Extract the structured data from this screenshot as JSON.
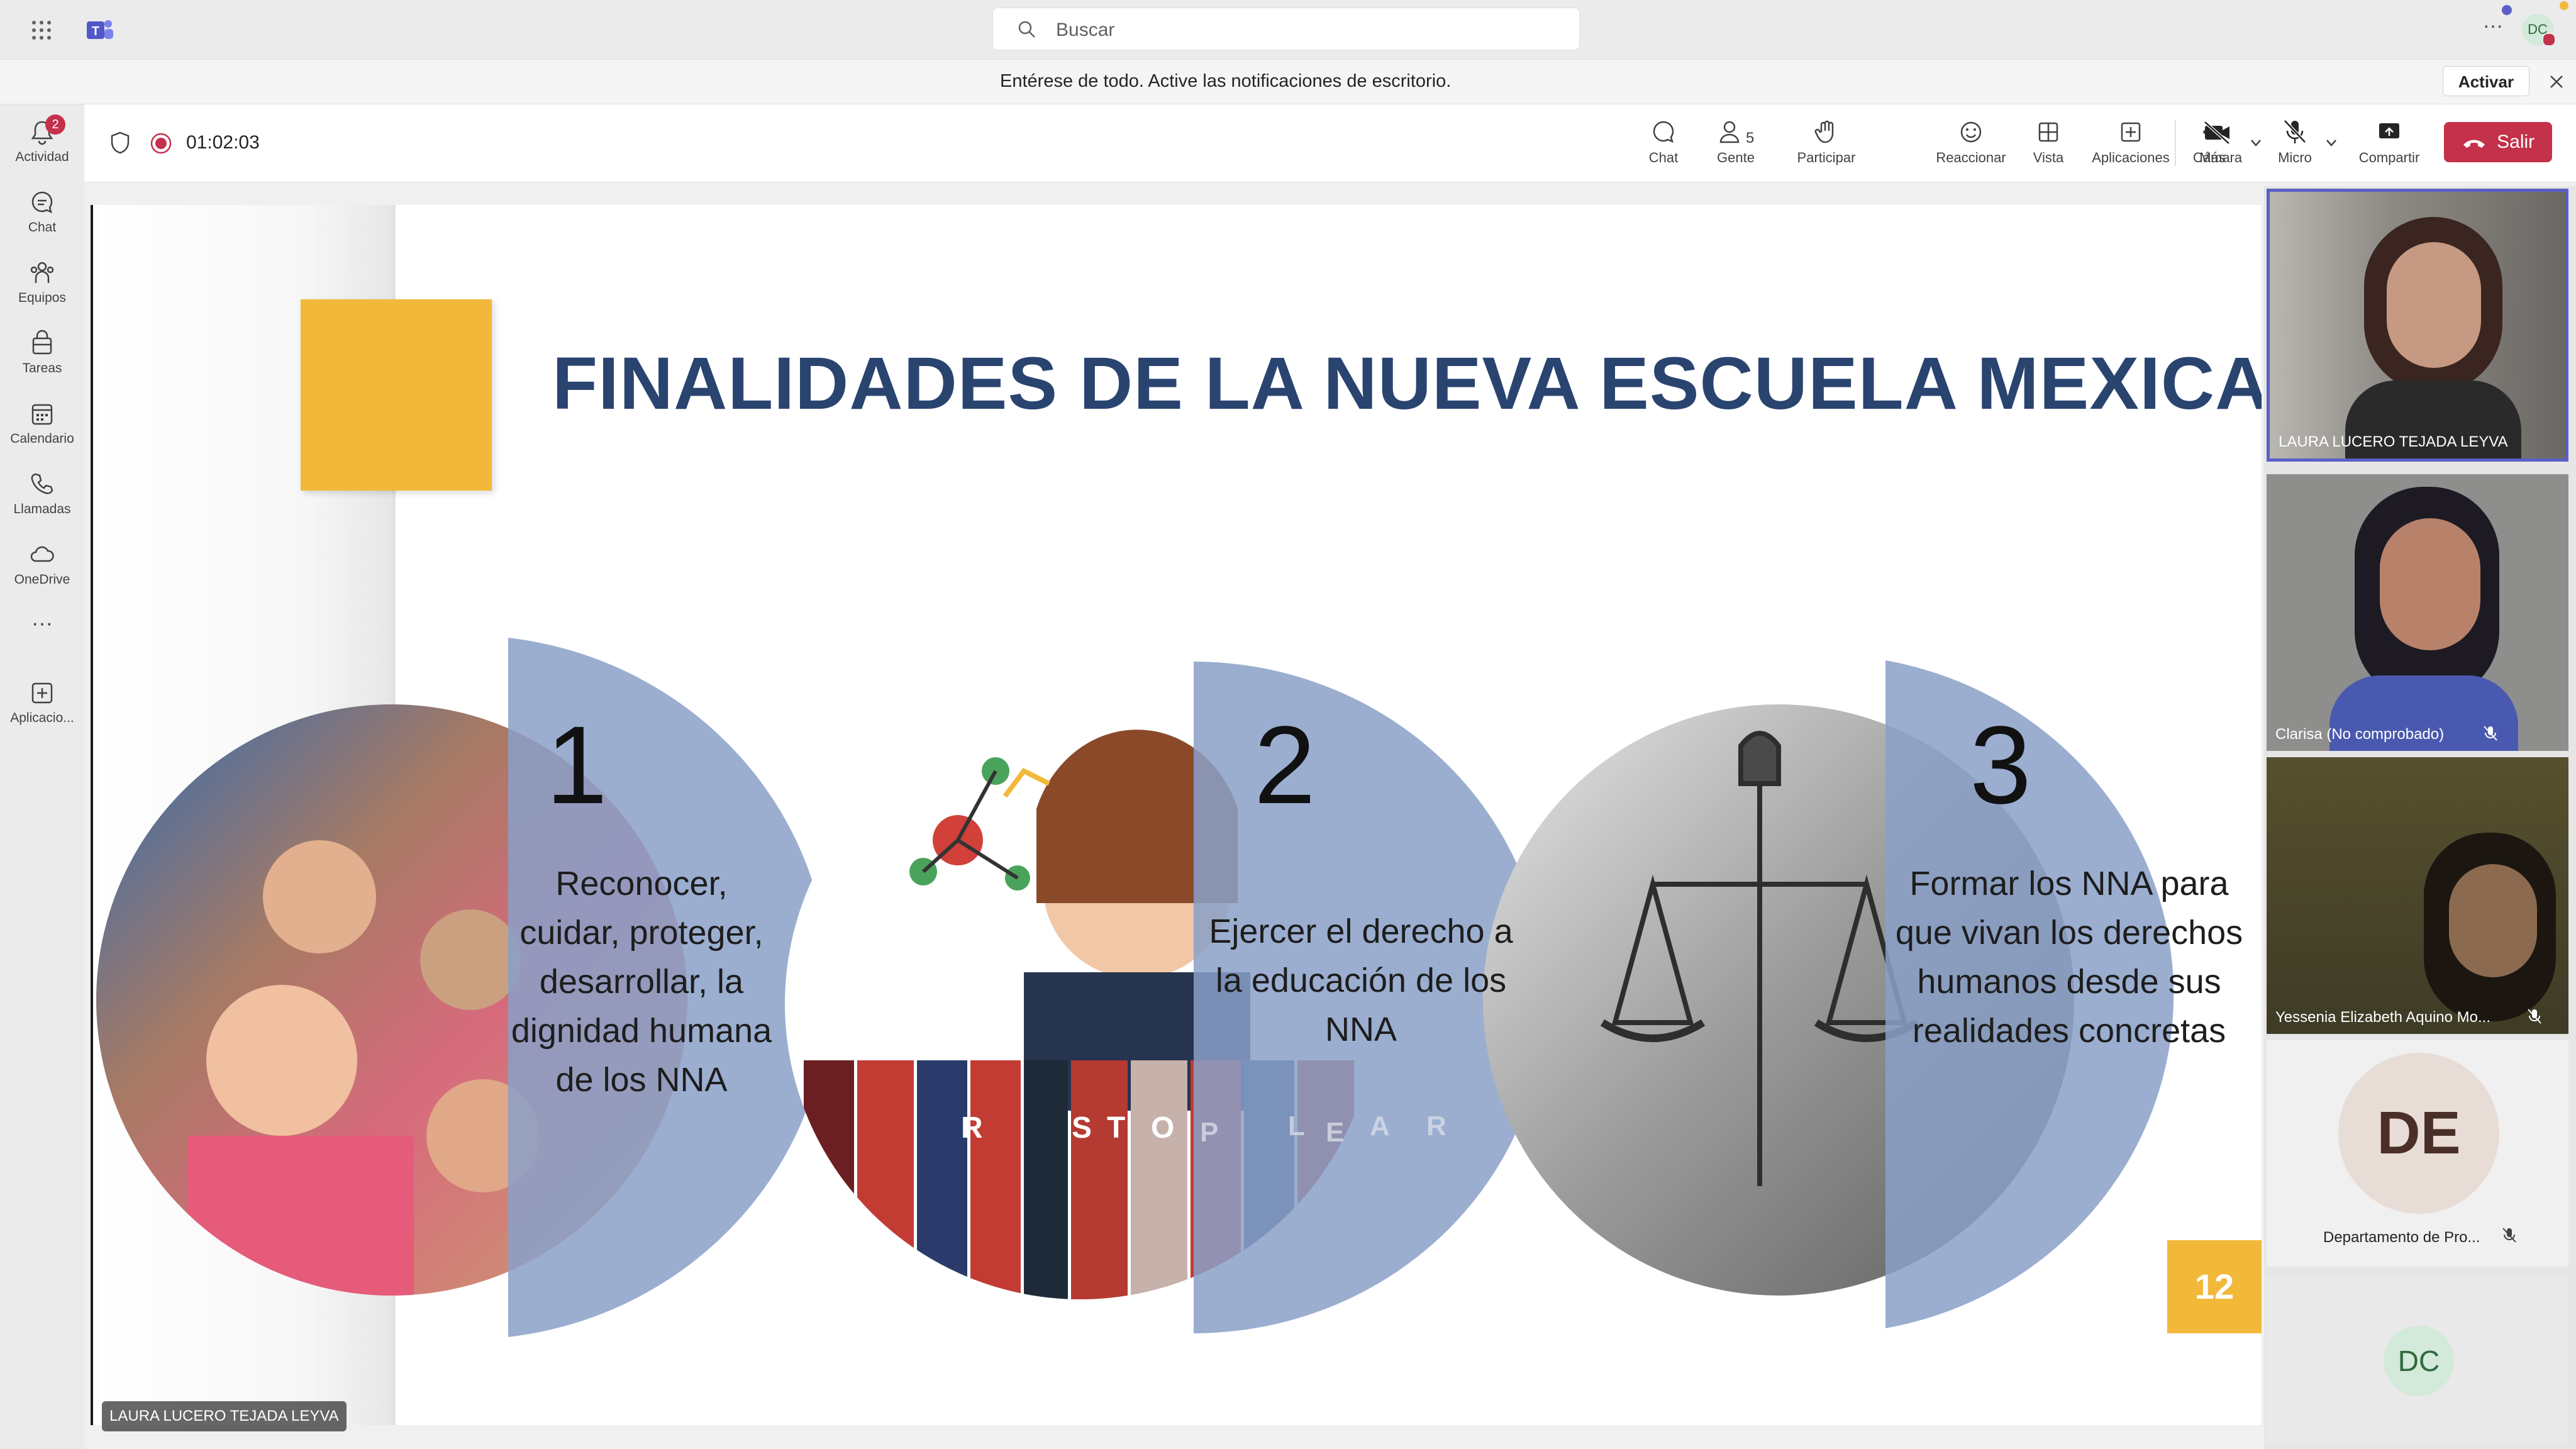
{
  "topbar": {
    "search_placeholder": "Buscar",
    "more_label": "···",
    "user_initials": "DC"
  },
  "notification": {
    "text": "Entérese de todo. Active las notificaciones de escritorio.",
    "button": "Activar"
  },
  "rail": {
    "items": [
      {
        "label": "Actividad",
        "icon": "bell-icon",
        "badge": "2"
      },
      {
        "label": "Chat",
        "icon": "chat-icon"
      },
      {
        "label": "Equipos",
        "icon": "teams-icon"
      },
      {
        "label": "Tareas",
        "icon": "tasks-icon"
      },
      {
        "label": "Calendario",
        "icon": "calendar-icon"
      },
      {
        "label": "Llamadas",
        "icon": "phone-icon"
      },
      {
        "label": "OneDrive",
        "icon": "cloud-icon"
      },
      {
        "label": "···",
        "icon": "more-icon"
      },
      {
        "label": "Aplicacio...",
        "icon": "add-apps-icon"
      }
    ]
  },
  "meeting": {
    "timer": "01:02:03",
    "people_count": "5",
    "toolbar": {
      "chat": "Chat",
      "people": "Gente",
      "raise": "Participar",
      "react": "Reaccionar",
      "view": "Vista",
      "apps": "Aplicaciones",
      "more": "Más",
      "camera": "Cámara",
      "mic": "Micro",
      "share": "Compartir",
      "leave": "Salir"
    }
  },
  "slide": {
    "title": "FINALIDADES DE LA NUEVA ESCUELA MEXICANA",
    "items": [
      {
        "number": "1",
        "text": "Reconocer, cuidar, proteger, desarrollar, la dignidad humana de los NNA"
      },
      {
        "number": "2",
        "text": "Ejercer el derecho a la educación de los NNA"
      },
      {
        "number": "3",
        "text": "Formar los NNA para que vivan los derechos humanos desde  sus realidades concretas"
      }
    ],
    "book_letters_left": [
      "R",
      "S",
      "T",
      "O"
    ],
    "book_letters_right": [
      "P",
      "L",
      "E",
      "A",
      "R"
    ],
    "page_number": "12",
    "presenter": "LAURA LUCERO TEJADA LEYVA"
  },
  "participants": [
    {
      "name": "LAURA LUCERO TEJADA LEYVA",
      "muted": false
    },
    {
      "name": "Clarisa (No comprobado)",
      "muted": true
    },
    {
      "name": "Yessenia Elizabeth Aquino Mo...",
      "muted": true
    },
    {
      "name": "Departamento de Pro...",
      "initials": "DE",
      "muted": true
    },
    {
      "initials": "DC"
    }
  ],
  "colors": {
    "accent": "#5b5fc7",
    "leave": "#c4314b",
    "slide_title": "#2a4470",
    "slide_yellow": "#f2b83a",
    "slide_overlay": "#8aa0c8"
  }
}
